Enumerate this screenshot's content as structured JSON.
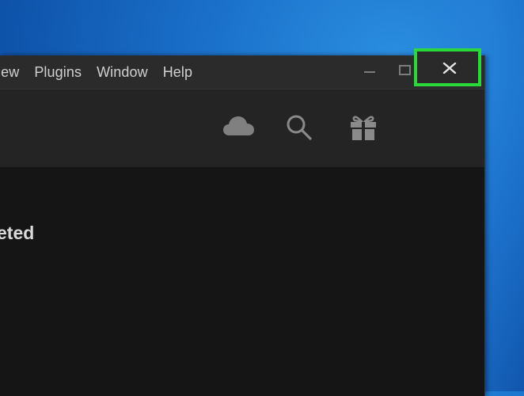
{
  "menubar": {
    "items": [
      {
        "label": "iew"
      },
      {
        "label": "Plugins"
      },
      {
        "label": "Window"
      },
      {
        "label": "Help"
      }
    ]
  },
  "window_controls": {
    "minimize": "minimize-icon",
    "maximize": "maximize-icon",
    "close": "close-icon",
    "highlight_color": "#2bd83b"
  },
  "toolbar": {
    "icons": [
      "cloud-icon",
      "search-icon",
      "gift-icon"
    ]
  },
  "main": {
    "heading": "eted"
  }
}
